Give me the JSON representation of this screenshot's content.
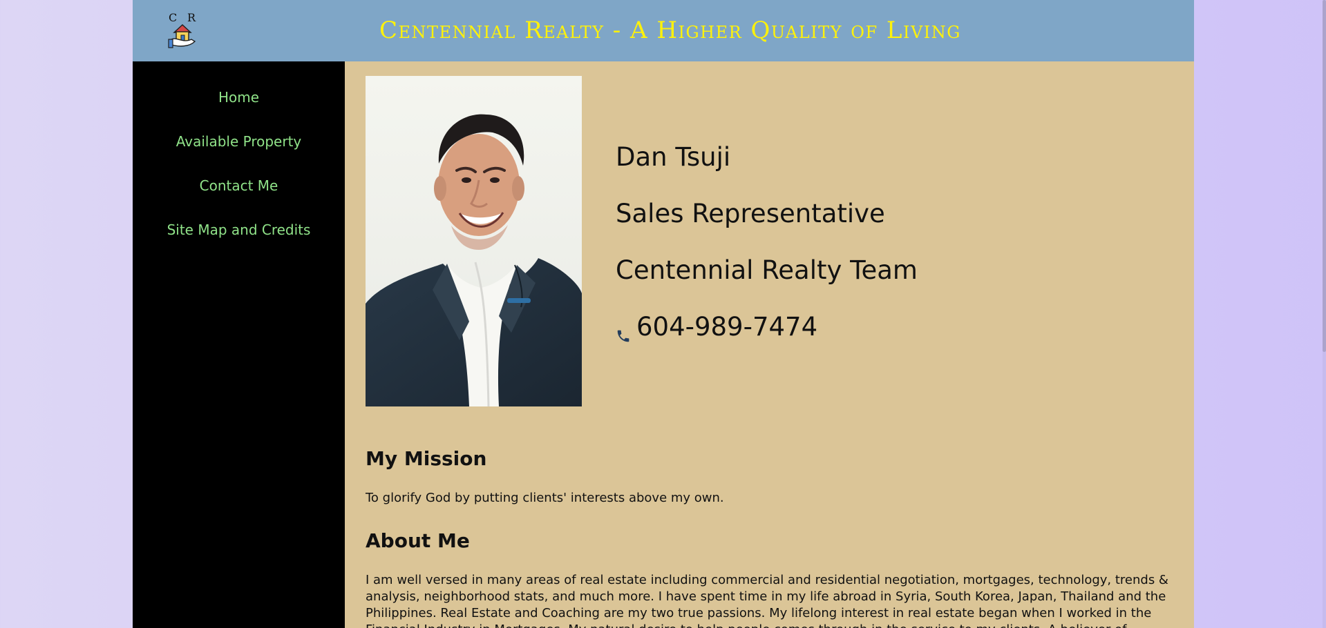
{
  "header": {
    "site_title": "Centennial Realty - A Higher Quality of Living",
    "logo_icon": "realty-house-hand-icon",
    "logo_letters": "C R"
  },
  "sidebar": {
    "items": [
      {
        "label": "Home"
      },
      {
        "label": "Available Property"
      },
      {
        "label": "Contact Me"
      },
      {
        "label": "Site Map and Credits"
      }
    ]
  },
  "profile": {
    "name": "Dan Tsuji",
    "role": "Sales Representative",
    "team": "Centennial Realty Team",
    "phone": "604-989-7474",
    "phone_icon": "phone-icon"
  },
  "mission": {
    "heading": "My Mission",
    "text": "To glorify God by putting clients' interests above my own."
  },
  "about": {
    "heading": "About Me",
    "text": "I am well versed in many areas of real estate including commercial and residential negotiation, mortgages, technology, trends & analysis, neighborhood stats, and much more. I have spent time in my life abroad in Syria, South Korea, Japan, Thailand and the Philippines. Real Estate and Coaching are my two true passions. My lifelong interest in real estate began when I worked in the Financial Industry in Mortgages. My natural desire to help people comes through in the service to my clients. A believer of"
  },
  "colors": {
    "header_bg": "#7fa6c7",
    "title": "#fff20a",
    "sidebar_bg": "#000000",
    "nav_link": "#90e389",
    "content_bg": "#dbc597",
    "page_bg": "#d6cdf6"
  }
}
